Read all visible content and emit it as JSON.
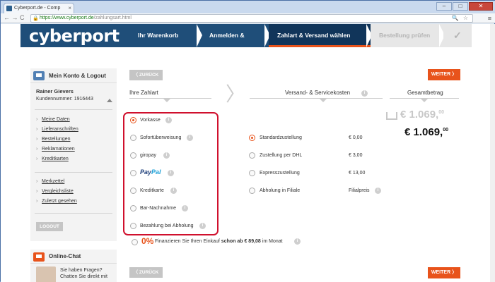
{
  "browser": {
    "tab_title": "Cyberport.de - Comp",
    "tab_close": "×",
    "url_host": "https://www.cyberport.de",
    "url_path": "/zahlungsart.html",
    "nav_icons": "← → C",
    "url_icons": "🔍 ☆",
    "menu_icon": "≡",
    "win_min": "–",
    "win_max": "□",
    "win_close": "✕"
  },
  "site": {
    "logo": "cyberport",
    "steps": [
      "Ihr Warenkorb",
      "Anmelden & Adresse",
      "Zahlart & Versand wählen",
      "Bestellung prüfen",
      "✓"
    ],
    "accent_color": "#e8531b",
    "brand_color": "#1f4e79"
  },
  "sidebar": {
    "title": "Mein Konto & Logout",
    "user_name": "Rainer Gievers",
    "customer_number": "Kundennummer: 1916443",
    "links": [
      "Meine Daten",
      "Lieferanschriften",
      "Bestellungen",
      "Reklamationen",
      "Kreditkarten"
    ],
    "links2": [
      "Merkzettel",
      "Vergleichsliste",
      "Zuletzt gesehen"
    ],
    "logout": "LOGOUT",
    "chat_title": "Online-Chat",
    "chat_line1": "Sie haben Fragen?",
    "chat_line2": "Chatten Sie direkt mit"
  },
  "main": {
    "back": "〈 ZURÜCK",
    "next": "WEITER 〉",
    "col_payment": "Ihre Zahlart",
    "col_shipping": "Versand- & Servicekosten",
    "col_total": "Gesamtbetrag",
    "info_glyph": "i",
    "payments": [
      {
        "label": "Vorkasse",
        "selected": true
      },
      {
        "label": "Sofortüberweisung",
        "selected": false
      },
      {
        "label": "giropay",
        "selected": false
      },
      {
        "label": "PayPal",
        "selected": false
      },
      {
        "label": "Kreditkarte",
        "selected": false
      },
      {
        "label": "Bar-Nachnahme",
        "selected": false
      },
      {
        "label": "Bezahlung bei Abholung",
        "selected": false
      }
    ],
    "paypal_pay": "Pay",
    "paypal_pal": "Pal",
    "shipping": [
      {
        "label": "Standardzustellung",
        "price": "€ 0,00",
        "selected": true
      },
      {
        "label": "Zustellung per DHL",
        "price": "€ 3,00",
        "selected": false
      },
      {
        "label": "Expresszustellung",
        "price": "€ 13,00",
        "selected": false
      },
      {
        "label": "Abholung in Filiale",
        "price": "Filialpreis",
        "selected": false
      }
    ],
    "old_total": "€ 1.069,",
    "old_total_cents": "00",
    "total": "€ 1.069,",
    "total_cents": "00",
    "finance_icon": "0%",
    "finance_text": "Finanzieren Sie Ihren Einkauf",
    "finance_bold": "schon ab € 89,08",
    "finance_suffix": "im Monat"
  }
}
